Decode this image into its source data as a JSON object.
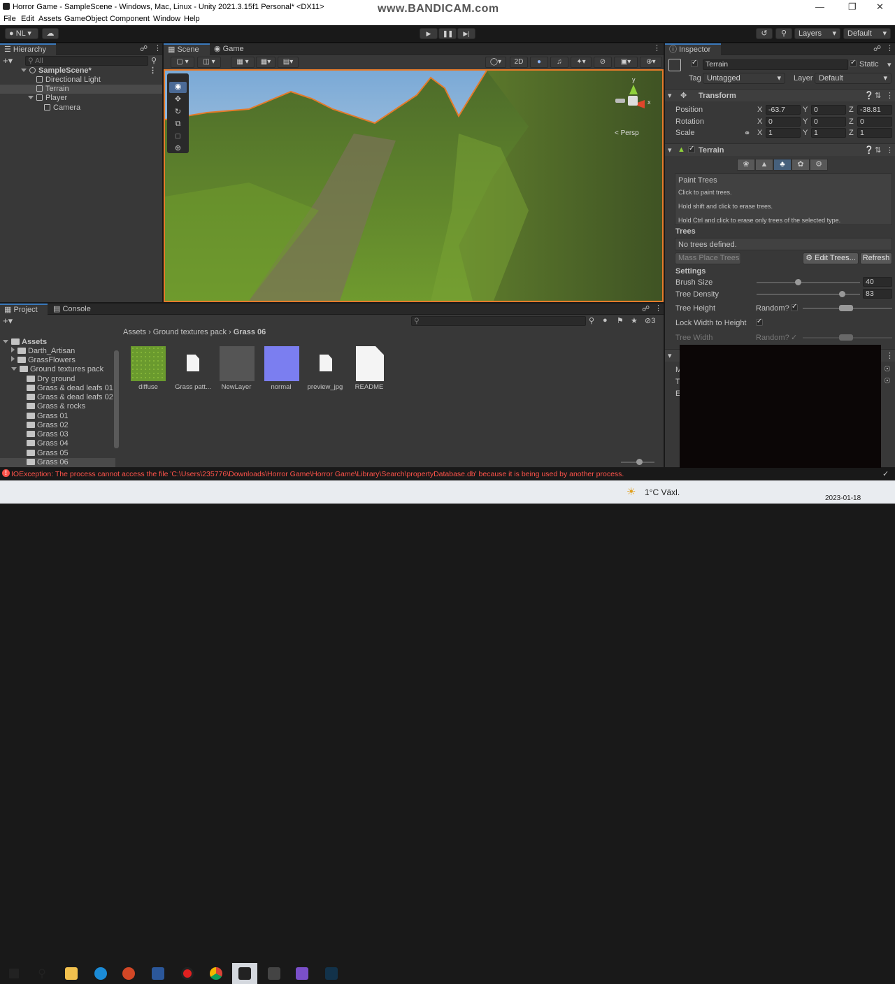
{
  "window": {
    "title": "Horror Game - SampleScene - Windows, Mac, Linux - Unity 2021.3.15f1 Personal* <DX11>",
    "watermark": "www.BANDICAM.com"
  },
  "menu": [
    "File",
    "Edit",
    "Assets",
    "GameObject",
    "Component",
    "Window",
    "Help"
  ],
  "toolbar": {
    "account": "NL",
    "layers": "Layers",
    "layout": "Default"
  },
  "hierarchy": {
    "tab": "Hierarchy",
    "search_placeholder": "All",
    "scene": "SampleScene*",
    "items": [
      "Directional Light",
      "Terrain",
      "Player",
      "Camera"
    ]
  },
  "scene": {
    "tabs": [
      "Scene",
      "Game"
    ],
    "mode_2d": "2D",
    "persp": "< Persp",
    "gizmo": {
      "y": "y",
      "x": "x"
    }
  },
  "inspector": {
    "tab": "Inspector",
    "object_name": "Terrain",
    "static": "Static",
    "tag_label": "Tag",
    "tag_value": "Untagged",
    "layer_label": "Layer",
    "layer_value": "Default",
    "transform": {
      "title": "Transform",
      "position": "Position",
      "rotation": "Rotation",
      "scale": "Scale",
      "x": "X",
      "y": "Y",
      "z": "Z",
      "pos": [
        "-63.7",
        "0",
        "-38.81"
      ],
      "rot": [
        "0",
        "0",
        "0"
      ],
      "scl": [
        "1",
        "1",
        "1"
      ]
    },
    "terrain": {
      "title": "Terrain",
      "paint_title": "Paint Trees",
      "lines": [
        "Click to paint trees.",
        "Hold shift and click to erase trees.",
        "Hold Ctrl and click to erase only trees of the selected type."
      ],
      "trees": "Trees",
      "no_trees": "No trees defined.",
      "mass_place": "Mass Place Trees",
      "edit_trees": "Edit Trees...",
      "refresh": "Refresh",
      "settings": "Settings",
      "brush_size": "Brush Size",
      "brush_value": "40",
      "brush_level": 0.4,
      "tree_density": "Tree Density",
      "density_value": "83",
      "density_level": 0.83,
      "tree_height": "Tree Height",
      "random": "Random?",
      "lock_width": "Lock Width to Height",
      "tree_width": "Tree Width"
    },
    "partial": [
      "M",
      "T",
      "E"
    ]
  },
  "project": {
    "tabs": [
      "Project",
      "Console"
    ],
    "breadcrumb": [
      "Assets",
      "Ground textures pack",
      "Grass 06"
    ],
    "count": "3",
    "tree_root": "Assets",
    "folders": [
      "Darth_Artisan",
      "GrassFlowers",
      "Ground textures pack"
    ],
    "sub": [
      "Dry ground",
      "Grass & dead leafs 01",
      "Grass & dead leafs 02",
      "Grass & rocks",
      "Grass 01",
      "Grass 02",
      "Grass 03",
      "Grass 04",
      "Grass 05",
      "Grass 06"
    ],
    "assets": [
      "diffuse",
      "Grass patt...",
      "NewLayer",
      "normal",
      "preview_jpg",
      "README"
    ]
  },
  "status": {
    "error": "IOException: The process cannot access the file 'C:\\Users\\235776\\Downloads\\Horror Game\\Horror Game\\Library\\Search\\propertyDatabase.db' because it is being used by another process."
  },
  "taskbar": {
    "weather": "1°C  Växl.",
    "date": "2023-01-18"
  },
  "colors": {
    "accent": "#3a79bb",
    "selection": "#4a4a4a",
    "error": "#ff534a",
    "grass": "#6f9a2e"
  }
}
